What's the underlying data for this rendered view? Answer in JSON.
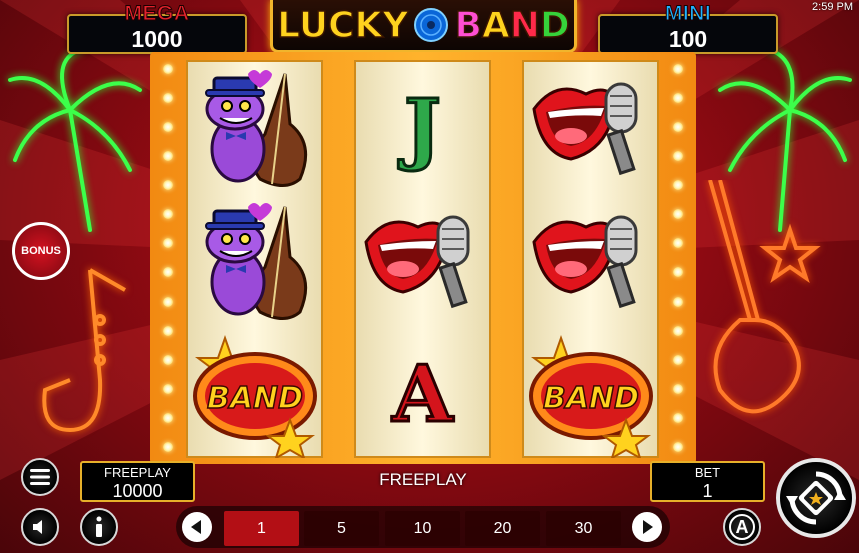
{
  "status_bar": {
    "time": "2:59 PM"
  },
  "jackpots": {
    "mega": {
      "label": "MEGA",
      "value": "1000"
    },
    "mini": {
      "label": "MINI",
      "value": "100"
    }
  },
  "logo": {
    "word1": "LUCKY",
    "word2": [
      "B",
      "A",
      "N",
      "D"
    ]
  },
  "reels": [
    [
      "frog-bassist-symbol",
      "frog-bassist-symbol",
      "band-symbol"
    ],
    [
      "letter-j-symbol",
      "lips-microphone-symbol",
      "letter-a-symbol"
    ],
    [
      "lips-microphone-symbol",
      "lips-microphone-symbol",
      "band-symbol"
    ]
  ],
  "symbols": {
    "letter_j": "J",
    "letter_a": "A",
    "band_text": "BAND"
  },
  "side": {
    "bonus_label": "BONUS"
  },
  "freeplay_panel": {
    "title": "FREEPLAY",
    "value": "10000"
  },
  "freeplay_center": "FREEPLAY",
  "bet_panel": {
    "title": "BET",
    "value": "1"
  },
  "bet_options": [
    "1",
    "5",
    "10",
    "20",
    "30"
  ],
  "selected_bet": "1",
  "autoplay_label": "A",
  "colors": {
    "mega": "#e2222c",
    "mini": "#1eb2ff",
    "frame": "#ffb32c",
    "active_bet": "#b30f15"
  }
}
